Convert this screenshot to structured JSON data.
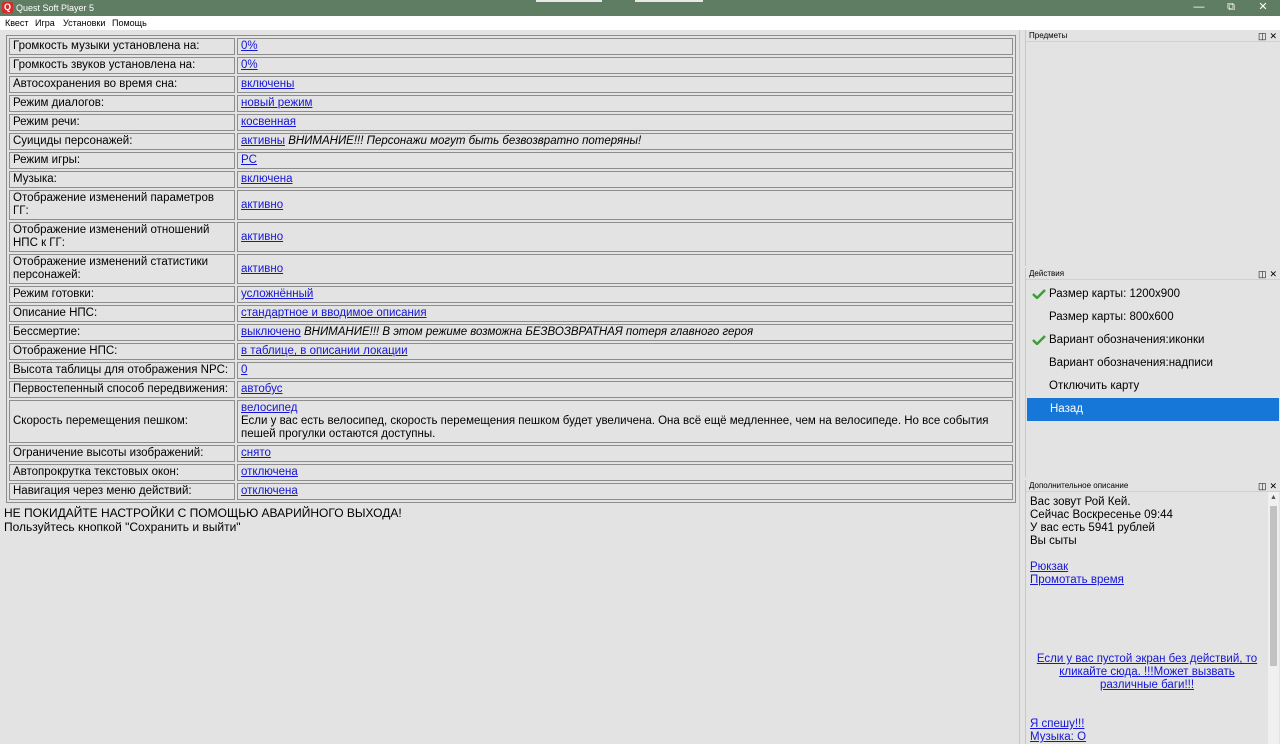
{
  "window": {
    "title": "Quest Soft Player 5",
    "icon_letter": "Q"
  },
  "menu": [
    "Квест",
    "Игра",
    "Установки",
    "Помощь"
  ],
  "settings": [
    {
      "label": "Громкость музыки установлена на:",
      "value": "0%",
      "note": ""
    },
    {
      "label": "Громкость звуков установлена на:",
      "value": "0%",
      "note": ""
    },
    {
      "label": "Автосохранения во время сна:",
      "value": "включены",
      "note": ""
    },
    {
      "label": "Режим диалогов:",
      "value": "новый режим",
      "note": ""
    },
    {
      "label": "Режим речи:",
      "value": "косвенная",
      "note": ""
    },
    {
      "label": "Суициды персонажей:",
      "value": "активны",
      "note": "ВНИМАНИЕ!!! Персонажи могут быть безвозвратно потеряны!"
    },
    {
      "label": "Режим игры:",
      "value": "PC",
      "note": ""
    },
    {
      "label": "Музыка:",
      "value": "включена",
      "note": ""
    },
    {
      "label": "Отображение изменений параметров ГГ:",
      "value": "активно",
      "note": ""
    },
    {
      "label": "Отображение изменений отношений НПС к ГГ:",
      "value": "активно",
      "note": ""
    },
    {
      "label": "Отображение изменений статистики персонажей:",
      "value": "активно",
      "note": ""
    },
    {
      "label": "Режим готовки:",
      "value": "усложнённый",
      "note": ""
    },
    {
      "label": "Описание НПС:",
      "value": "стандартное и вводимое описания",
      "note": ""
    },
    {
      "label": "Бессмертие:",
      "value": "выключено",
      "note": "ВНИМАНИЕ!!! В этом режиме возможна БЕЗВОЗВРАТНАЯ потеря главного героя"
    },
    {
      "label": "Отображение НПС:",
      "value": "в таблице, в описании локации",
      "note": ""
    },
    {
      "label": "Высота таблицы для отображения NPC:",
      "value": "0",
      "note": ""
    },
    {
      "label": "Первостепенный способ передвижения:",
      "value": "автобус",
      "note": ""
    },
    {
      "label": "Скорость перемещения пешком:",
      "value": "велосипед",
      "note": "Если у вас есть велосипед, скорость перемещения пешком будет увеличена. Она всё ещё медленнее, чем на велосипеде. Но все события пешей прогулки остаются доступны."
    },
    {
      "label": "Ограничение высоты изображений:",
      "value": "снято",
      "note": ""
    },
    {
      "label": "Автопрокрутка текстовых окон:",
      "value": "отключена",
      "note": ""
    },
    {
      "label": "Навигация через меню действий:",
      "value": "отключена",
      "note": ""
    }
  ],
  "notice": {
    "line1": "НЕ ПОКИДАЙТЕ НАСТРОЙКИ С ПОМОЩЬЮ АВАРИЙНОГО ВЫХОДА!",
    "line2": "Пользуйтесь кнопкой \"Сохранить и выйти\""
  },
  "items_panel": {
    "title": "Предметы"
  },
  "actions_panel": {
    "title": "Действия",
    "items": [
      {
        "label": "Размер карты: 1200x900",
        "checked": true,
        "selected": false
      },
      {
        "label": "Размер карты: 800x600",
        "checked": false,
        "selected": false
      },
      {
        "label": "Вариант обозначения:иконки",
        "checked": true,
        "selected": false
      },
      {
        "label": "Вариант обозначения:надписи",
        "checked": false,
        "selected": false
      },
      {
        "label": "Отключить карту",
        "checked": false,
        "selected": false
      },
      {
        "label": "Назад",
        "checked": false,
        "selected": true
      }
    ]
  },
  "desc_panel": {
    "title": "Дополнительное описание",
    "lines": [
      "Вас зовут Рой Кей.",
      "Сейчас Воскресенье 09:44",
      "У вас есть 5941 рублей",
      "Вы сыты"
    ],
    "links": [
      "Рюкзак",
      "Промотать время"
    ],
    "help_link": "Если у вас пустой экран без действий, то кликайте сюда. !!!Может вызвать различные баги!!!",
    "bottom_links": [
      "Я спешу!!!",
      "Музыка: О"
    ]
  },
  "colors": {
    "titlebar": "#5f7d62",
    "link": "#1515d6",
    "selected": "#1677d8",
    "check": "#3aa03a"
  }
}
